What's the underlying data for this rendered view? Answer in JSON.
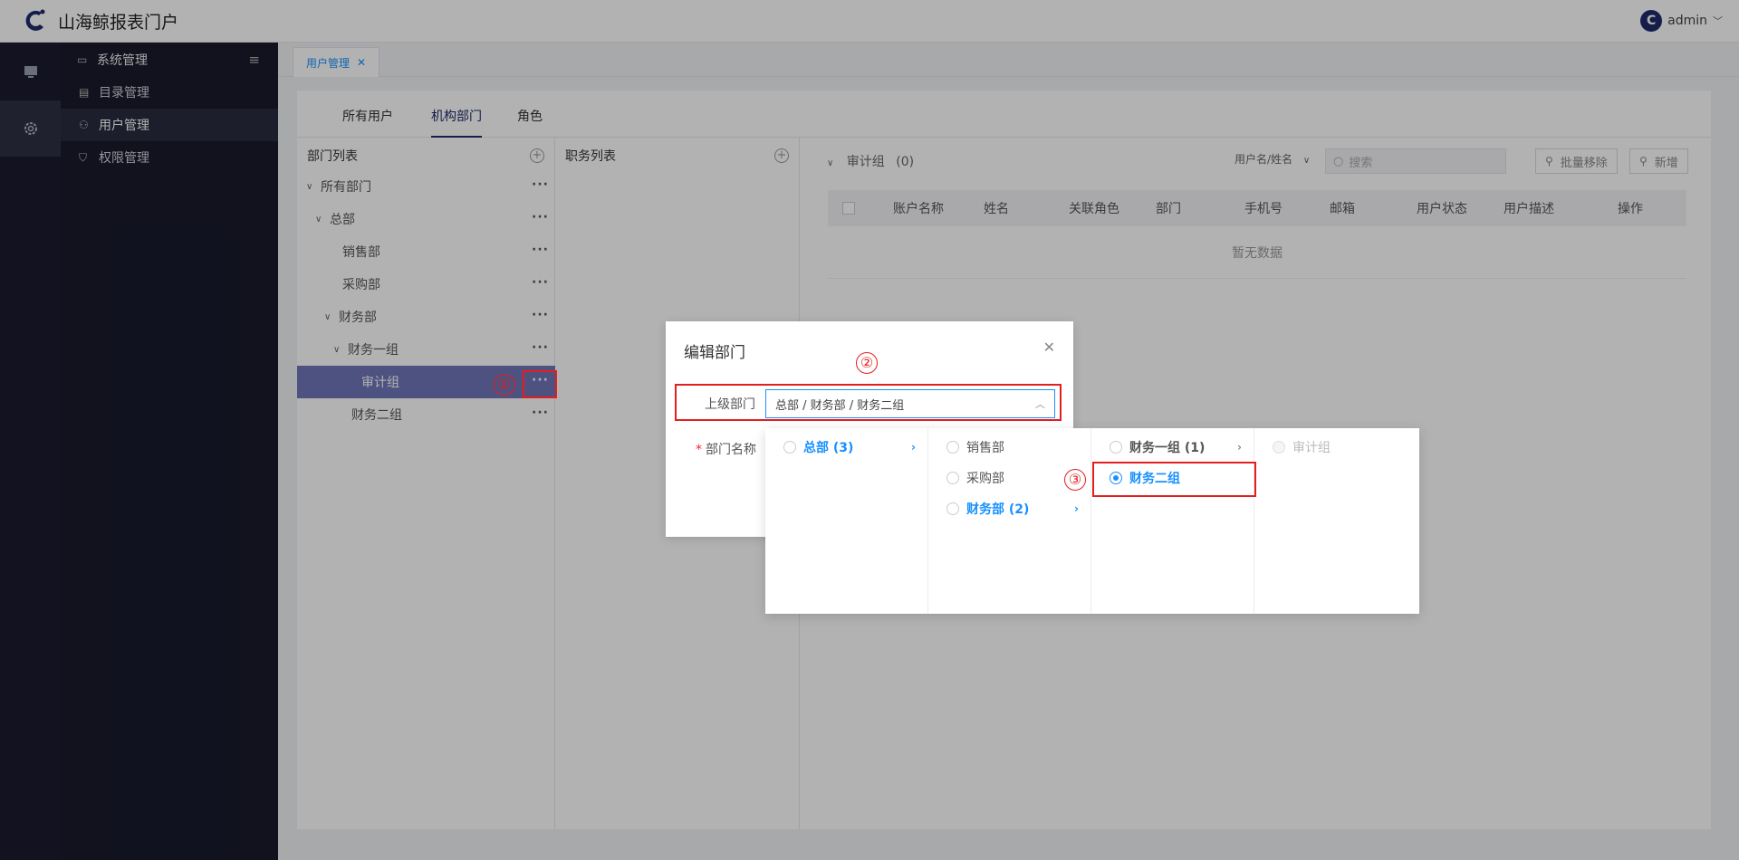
{
  "app": {
    "title": "山海鲸报表门户",
    "user": "admin",
    "avatar_letter": "C"
  },
  "sidebar": {
    "header": "系统管理",
    "items": [
      {
        "label": "目录管理",
        "icon": "document-icon"
      },
      {
        "label": "用户管理",
        "icon": "users-icon",
        "active": true
      },
      {
        "label": "权限管理",
        "icon": "shield-icon"
      }
    ]
  },
  "tabs": [
    {
      "label": "用户管理"
    }
  ],
  "subtabs": [
    "所有用户",
    "机构部门",
    "角色"
  ],
  "dept_panel": {
    "title": "部门列表",
    "tree": [
      {
        "label": "所有部门",
        "level": 0,
        "expanded": true
      },
      {
        "label": "总部",
        "level": 1,
        "expanded": true
      },
      {
        "label": "销售部",
        "level": 2
      },
      {
        "label": "采购部",
        "level": 2
      },
      {
        "label": "财务部",
        "level": 2,
        "expanded": true
      },
      {
        "label": "财务一组",
        "level": 3,
        "expanded": true
      },
      {
        "label": "审计组",
        "level": 4,
        "selected": true
      },
      {
        "label": "财务二组",
        "level": 3
      }
    ]
  },
  "position_panel": {
    "title": "职务列表"
  },
  "user_table": {
    "group_label": "审计组",
    "group_count": "(0)",
    "filter_field": "用户名/姓名",
    "search_placeholder": "搜索",
    "batch_remove": "批量移除",
    "add_new": "新增",
    "columns": [
      "账户名称",
      "姓名",
      "关联角色",
      "部门",
      "手机号",
      "邮箱",
      "用户状态",
      "用户描述",
      "操作"
    ],
    "empty_text": "暂无数据"
  },
  "dialog": {
    "title": "编辑部门",
    "parent_label": "上级部门",
    "parent_value": "总部 / 财务部 / 财务二组",
    "name_label": "部门名称",
    "required_mark": "*"
  },
  "cascader": {
    "columns": [
      [
        {
          "label": "总部 (3)",
          "active": true,
          "expand": true
        }
      ],
      [
        {
          "label": "销售部"
        },
        {
          "label": "采购部"
        },
        {
          "label": "财务部 (2)",
          "active": true,
          "expand": true
        }
      ],
      [
        {
          "label": "财务一组 (1)",
          "bold": true,
          "expand": true
        },
        {
          "label": "财务二组",
          "active": true,
          "checked": true
        }
      ],
      [
        {
          "label": "审计组",
          "disabled": true
        }
      ]
    ]
  },
  "annotations": [
    "①",
    "②",
    "③"
  ],
  "colors": {
    "accent": "#1890ff",
    "sidebar": "#191a2c",
    "selected_row": "#7076b8",
    "annotation": "#e41e1e"
  }
}
